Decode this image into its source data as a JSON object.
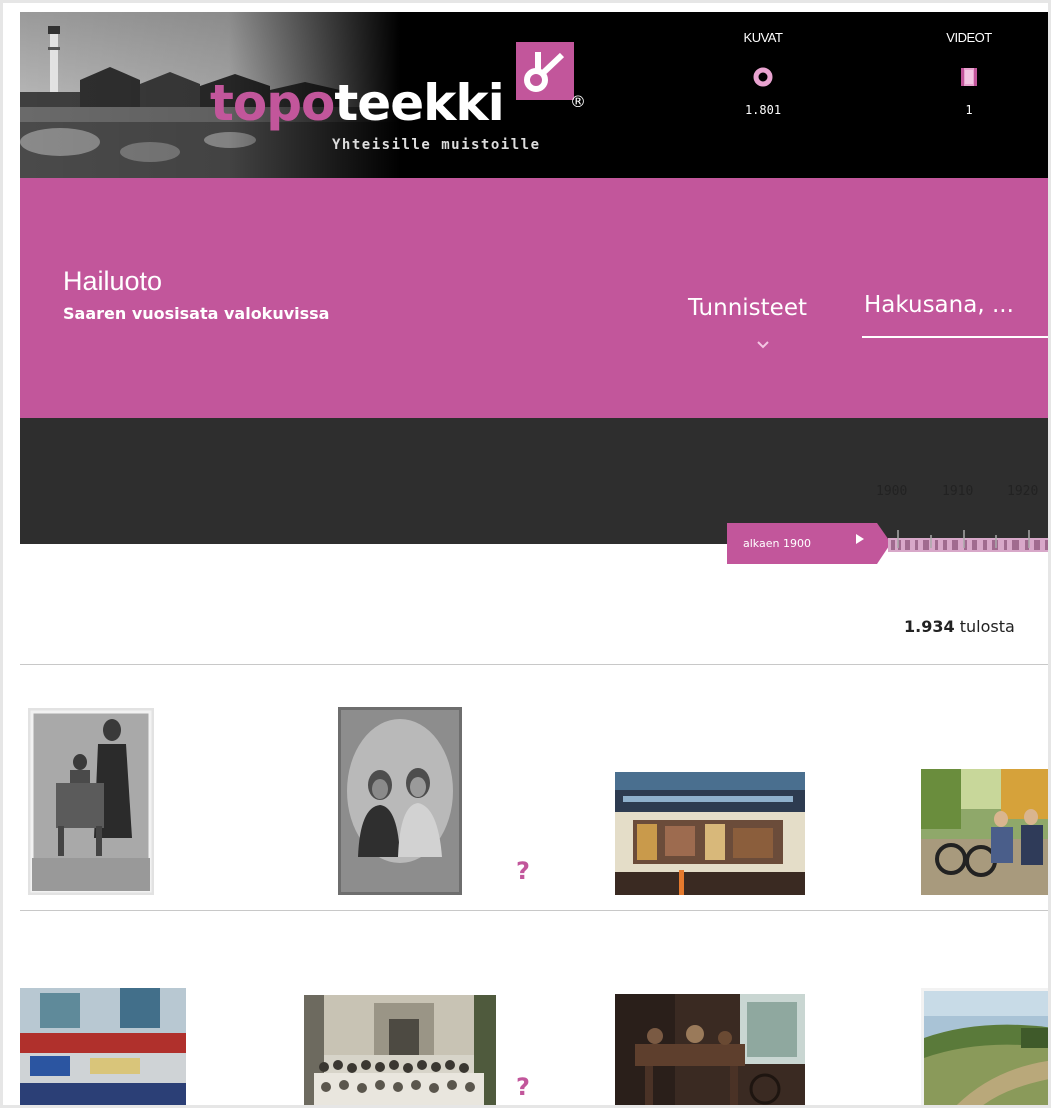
{
  "brand": {
    "logo_part1": "topo",
    "logo_part2": "teekki",
    "registered_mark": "®",
    "tagline": "Yhteisille muistoille"
  },
  "media_types": [
    {
      "label": "KUVAT",
      "count": "1.801",
      "icon": "photo-ring-icon"
    },
    {
      "label": "VIDEOT",
      "count": "1",
      "icon": "film-icon"
    }
  ],
  "site": {
    "title": "Hailuoto",
    "subtitle": "Saaren vuosisata valokuvissa"
  },
  "nav": {
    "tags_label": "Tunnisteet",
    "search_placeholder": "Hakusana, ..."
  },
  "timeline": {
    "start_label": "alkaen 1900",
    "years": [
      "1900",
      "1910",
      "1920"
    ]
  },
  "results": {
    "count": "1.934",
    "suffix": "tulosta"
  },
  "grid": {
    "unknown_marker": "?"
  },
  "colors": {
    "accent": "#c2569b",
    "header_bg": "#000000",
    "timeline_bg": "#2e2e2e"
  }
}
